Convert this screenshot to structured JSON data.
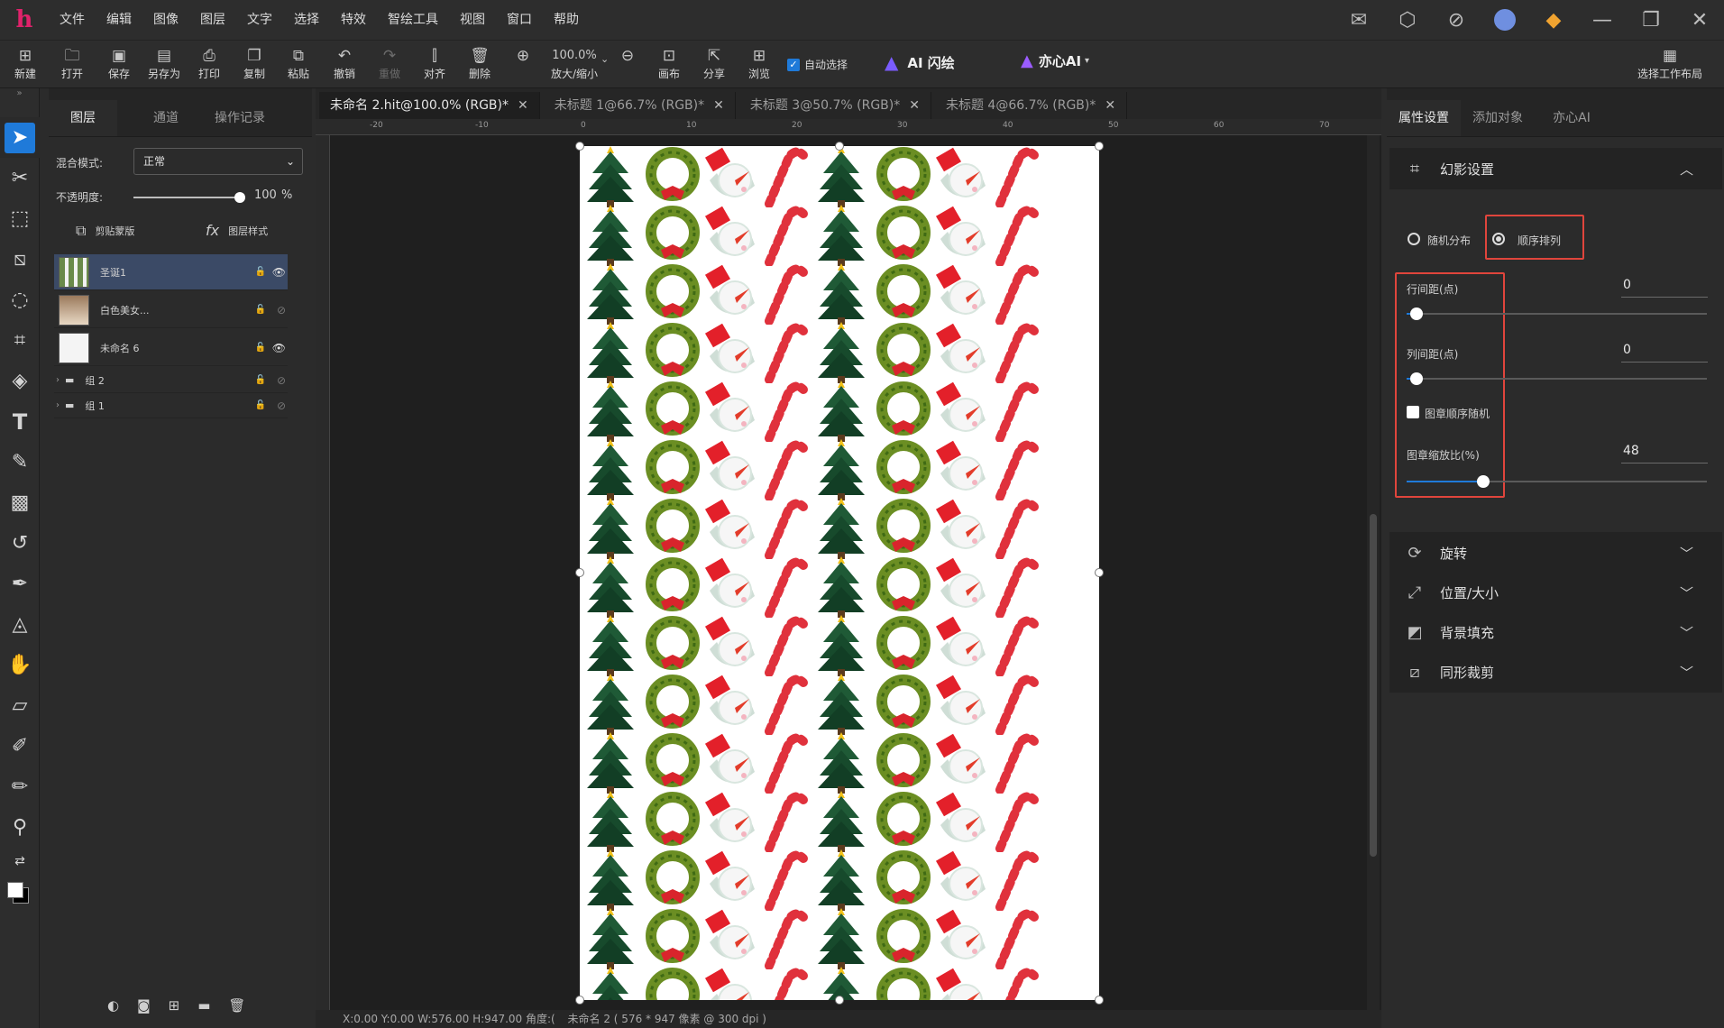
{
  "app": {
    "logo": "h"
  },
  "menu": [
    "文件",
    "编辑",
    "图像",
    "图层",
    "文字",
    "选择",
    "特效",
    "智绘工具",
    "视图",
    "窗口",
    "帮助"
  ],
  "topright_icons": [
    "mail-icon",
    "settings-hex-icon",
    "compass-icon",
    "avatar",
    "gem-icon",
    "minimize-icon",
    "restore-icon",
    "close-icon"
  ],
  "toolbar": {
    "new": "新建",
    "open": "打开",
    "save": "保存",
    "saveas": "另存为",
    "print": "打印",
    "copy": "复制",
    "paste": "粘贴",
    "undo": "撤销",
    "redo": "重做",
    "align": "对齐",
    "delete": "删除",
    "zoom_value": "100.0%",
    "zoom_label": "放大/缩小",
    "canvas": "画布",
    "share": "分享",
    "browse": "浏览",
    "auto_select": "自动选择",
    "ai_flash": "AI 闪绘",
    "yixin": "亦心AI",
    "workspace": "选择工作布局"
  },
  "layers_panel": {
    "tabs": [
      "图层",
      "通道",
      "操作记录"
    ],
    "blend_label": "混合模式:",
    "blend_value": "正常",
    "opacity_label": "不透明度:",
    "opacity_value": "100",
    "opacity_unit": "%",
    "clip_mask": "剪贴蒙版",
    "layer_style": "图层样式",
    "layers": [
      {
        "name": "圣诞1",
        "selected": true,
        "visible": true
      },
      {
        "name": "白色美女...",
        "selected": false,
        "visible": false
      },
      {
        "name": "未命名 6",
        "selected": false,
        "visible": true
      },
      {
        "name": "组 2",
        "group": true,
        "visible": false
      },
      {
        "name": "组 1",
        "group": true,
        "visible": false
      }
    ]
  },
  "doc_tabs": [
    {
      "label": "未命名 2.hit@100.0% (RGB)*",
      "active": true
    },
    {
      "label": "未标题 1@66.7% (RGB)*",
      "active": false
    },
    {
      "label": "未标题 3@50.7% (RGB)*",
      "active": false
    },
    {
      "label": "未标题 4@66.7% (RGB)*",
      "active": false
    }
  ],
  "ruler_labels": [
    "-20",
    "-10",
    "0",
    "10",
    "20",
    "30",
    "40",
    "50",
    "60",
    "70"
  ],
  "status": {
    "text": "X:0.00 Y:0.00 W:576.00 H:947.00 角度:(",
    "doc": "未命名 2 ( 576 * 947 像素 @ 300 dpi )"
  },
  "right_panel": {
    "tabs": [
      "属性设置",
      "添加对象",
      "亦心AI"
    ],
    "phantom": {
      "title": "幻影设置",
      "random": "随机分布",
      "sequence": "顺序排列",
      "row_label": "行间距(点)",
      "row_value": "0",
      "col_label": "列间距(点)",
      "col_value": "0",
      "random_order": "图章顺序随机",
      "scale_label": "图章缩放比(%)",
      "scale_value": "48"
    },
    "sections": [
      "旋转",
      "位置/大小",
      "背景填充",
      "同形裁剪"
    ]
  },
  "colors": {
    "accent": "#1f7ad9",
    "highlight": "#e0453c",
    "logo": "#e0226b"
  }
}
